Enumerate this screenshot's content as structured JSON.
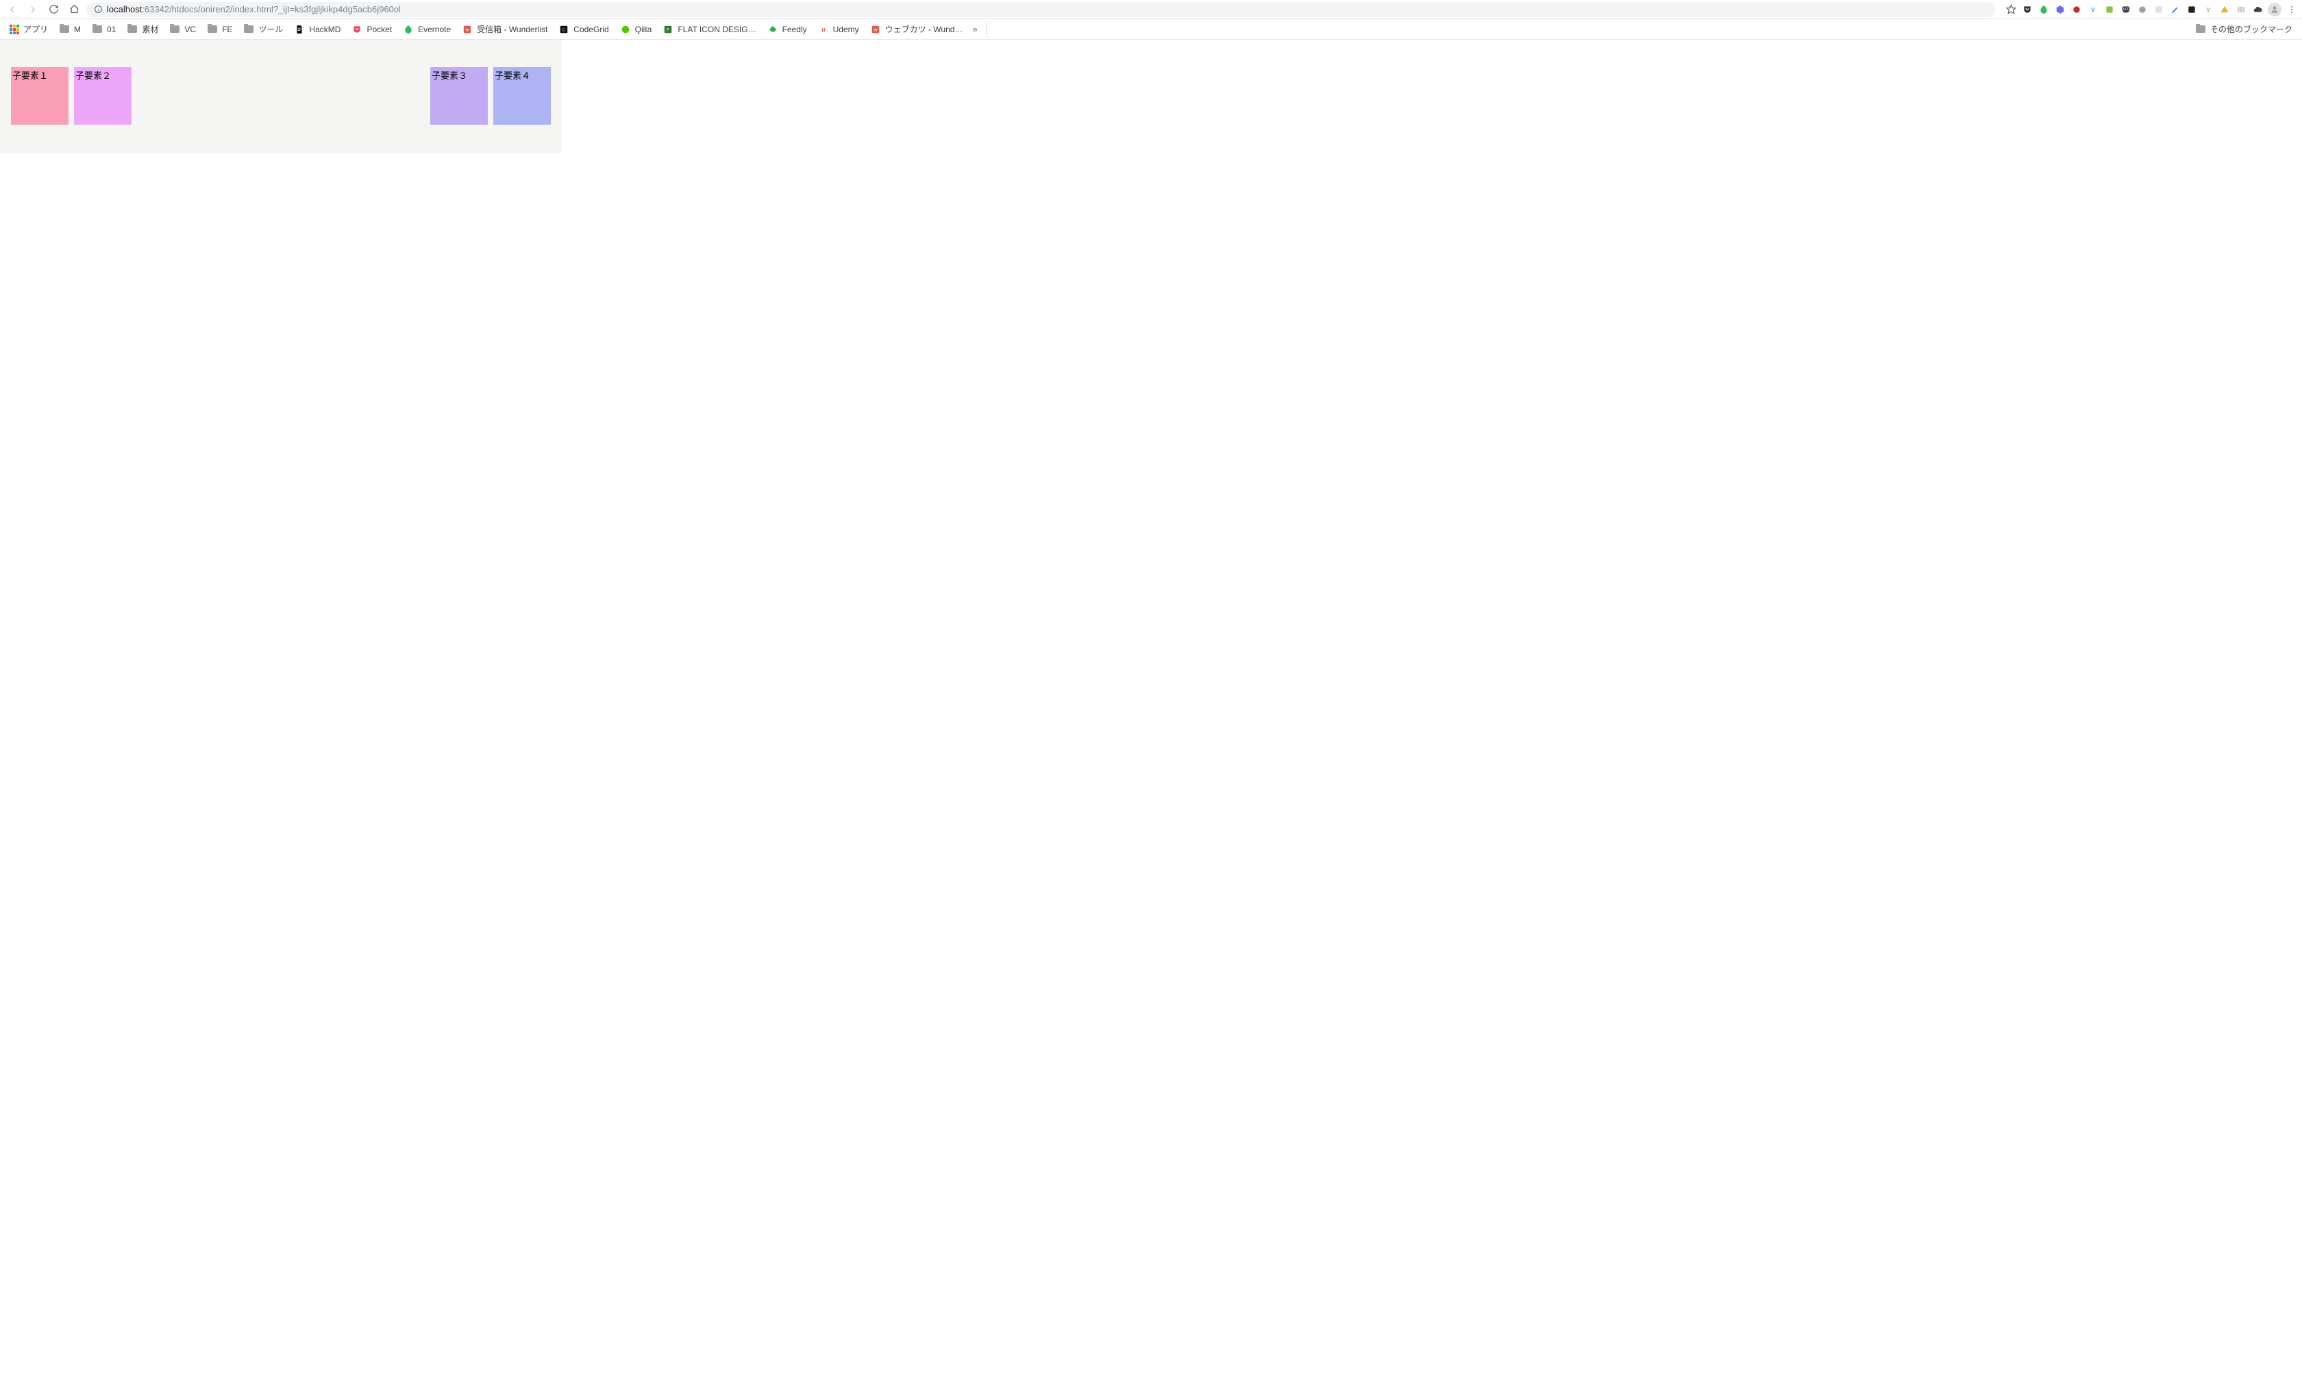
{
  "browser": {
    "address": {
      "host": "localhost",
      "rest": ":63342/htdocs/oniren2/index.html?_ijt=ks3fgjljkikp4dg5acb6j960ol"
    },
    "apps_label": "アプリ"
  },
  "bookmarks": {
    "folders": [
      "M",
      "01",
      "素材",
      "VC",
      "FE",
      "ツール"
    ],
    "items": [
      {
        "label": "HackMD",
        "icon": "doc",
        "color": "#000000"
      },
      {
        "label": "Pocket",
        "icon": "pocket",
        "color": "#ee4056"
      },
      {
        "label": "Evernote",
        "icon": "evernote",
        "color": "#2dbe60"
      },
      {
        "label": "受信箱 - Wunderlist",
        "icon": "wunder",
        "color": "#e2574c"
      },
      {
        "label": "CodeGrid",
        "icon": "codegrid",
        "color": "#111111"
      },
      {
        "label": "Qiita",
        "icon": "qiita",
        "color": "#55c500"
      },
      {
        "label": "FLAT ICON DESIG…",
        "icon": "flaticon",
        "color": "#2e7d32"
      },
      {
        "label": "Feedly",
        "icon": "feedly",
        "color": "#2bb24c"
      },
      {
        "label": "Udemy",
        "icon": "udemy",
        "color": "#ec5252"
      },
      {
        "label": "ウェブカツ - Wund…",
        "icon": "webkatsu",
        "color": "#e2574c"
      }
    ],
    "overflow": "»",
    "other_label": "その他のブックマーク"
  },
  "extension_icons": [
    {
      "name": "star-icon",
      "color": "#5f6368",
      "shape": "star"
    },
    {
      "name": "pocket-ext-icon",
      "color": "#333333",
      "shape": "pocket"
    },
    {
      "name": "evernote-ext-icon",
      "color": "#2dbe60",
      "shape": "leaf"
    },
    {
      "name": "cube-ext-icon",
      "color": "#6b6bff",
      "shape": "cube"
    },
    {
      "name": "panda-ext-icon",
      "color": "#c62828",
      "shape": "circle"
    },
    {
      "name": "y-ext-icon",
      "color": "#2196f3",
      "shape": "letter"
    },
    {
      "name": "green-ext-icon",
      "color": "#8bc34a",
      "shape": "square"
    },
    {
      "name": "off-ext-icon",
      "color": "#424242",
      "shape": "tag"
    },
    {
      "name": "grey-circle-icon",
      "color": "#9e9e9e",
      "shape": "circle"
    },
    {
      "name": "empty-ext-icon",
      "color": "#e0e0e0",
      "shape": "square"
    },
    {
      "name": "pencil-ext-icon",
      "color": "#1976d2",
      "shape": "pencil"
    },
    {
      "name": "dark-ext-icon",
      "color": "#212121",
      "shape": "square"
    },
    {
      "name": "grey-v-icon",
      "color": "#9e9e9e",
      "shape": "letter"
    },
    {
      "name": "drive-ext-icon",
      "color": "#f9a825",
      "shape": "triangle"
    },
    {
      "name": "barcode-ext-icon",
      "color": "#9e9e9e",
      "shape": "barcode"
    },
    {
      "name": "cloud-ext-icon",
      "color": "#424242",
      "shape": "cloud"
    }
  ],
  "page": {
    "boxes": [
      {
        "label": "子要素１",
        "color": "#fb9fb6"
      },
      {
        "label": "子要素２",
        "color": "#eda6f9"
      },
      {
        "label": "子要素３",
        "color": "#c1acf3"
      },
      {
        "label": "子要素４",
        "color": "#aeb3f4"
      }
    ]
  }
}
